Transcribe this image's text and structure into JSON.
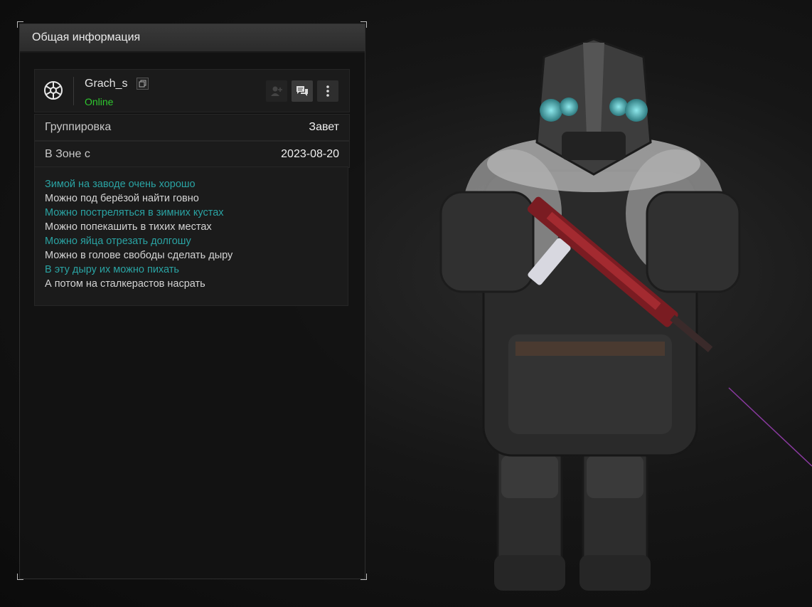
{
  "panel": {
    "title": "Общая информация"
  },
  "user": {
    "name": "Grach_s",
    "status": "Online",
    "status_color": "#2fc82f",
    "logo_icon": "snowflake-emblem-icon",
    "actions": [
      {
        "name": "add-friend-button",
        "icon": "add-friend-icon",
        "enabled": false
      },
      {
        "name": "message-button",
        "icon": "chat-icon",
        "enabled": true
      },
      {
        "name": "more-options-button",
        "icon": "vertical-dots-icon",
        "enabled": true
      }
    ]
  },
  "info": {
    "faction_label": "Группировка",
    "faction_value": "Завет",
    "zone_label": "В Зоне с",
    "zone_value": "2023-08-20"
  },
  "bio": {
    "lines": [
      {
        "text": "Зимой на заводе очень хорошо",
        "style": "teal"
      },
      {
        "text": "Можно под берёзой найти говно",
        "style": "white"
      },
      {
        "text": "Можно пострелять­ся в зимних кустах",
        "style": "teal"
      },
      {
        "text": "Можно попекашить в тихих местах",
        "style": "white"
      },
      {
        "text": "Можно яйца отрезать долгошу",
        "style": "teal"
      },
      {
        "text": "Можно в голове свободы сделать дыру",
        "style": "white"
      },
      {
        "text": "В эту дыру их можно пихать",
        "style": "teal"
      },
      {
        "text": "А потом на сталкерастов насрать",
        "style": "white"
      }
    ]
  },
  "colors": {
    "accent_teal": "#2aa3a3",
    "panel_bg": "#121212"
  }
}
